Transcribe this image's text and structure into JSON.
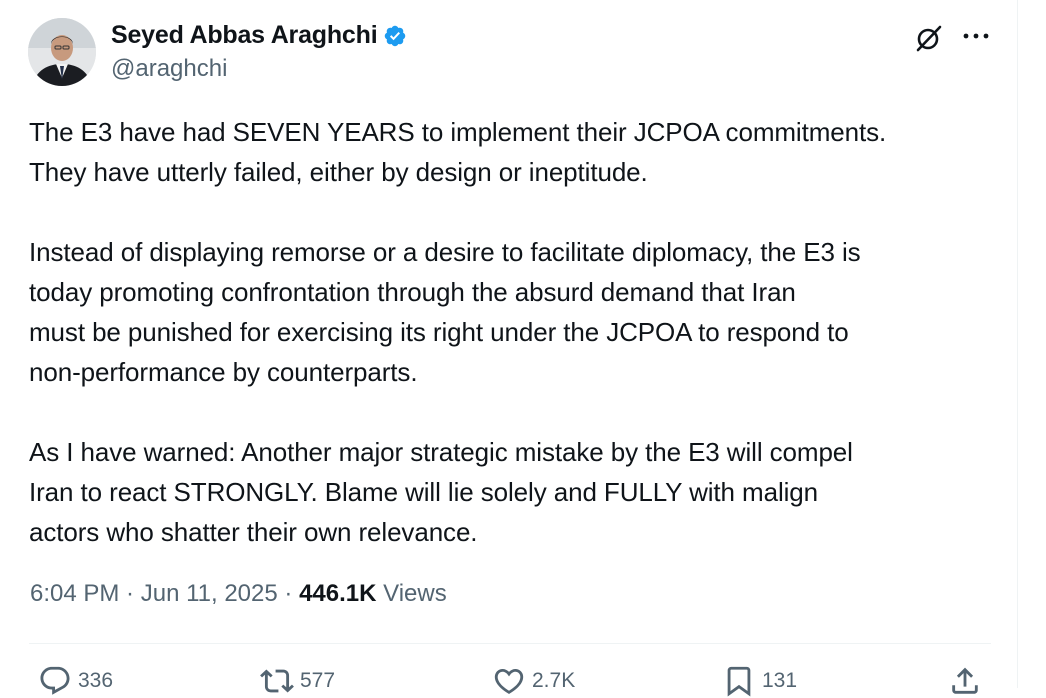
{
  "author": {
    "display_name": "Seyed Abbas Araghchi",
    "handle": "@araghchi",
    "verified": true,
    "verified_color": "#1d9bf0"
  },
  "tweet": {
    "paragraphs": [
      {
        "lines": [
          "The E3 have had SEVEN YEARS to implement their JCPOA commitments.",
          "They have utterly failed, either by design or ineptitude."
        ]
      },
      {
        "lines": [
          "Instead of displaying remorse or a desire to facilitate diplomacy, the E3 is",
          "today promoting confrontation through the absurd demand that Iran",
          "must be punished for exercising its right under the JCPOA to respond to",
          "non-performance by counterparts."
        ]
      },
      {
        "lines": [
          "As I have warned: Another major strategic mistake by the E3 will compel",
          "Iran to react STRONGLY. Blame will lie solely and FULLY with malign",
          "actors who shatter their own relevance."
        ]
      }
    ]
  },
  "meta": {
    "time": "6:04 PM",
    "separator": " · ",
    "date": "Jun 11, 2025",
    "views_count": "446.1K",
    "views_label": " Views"
  },
  "actions": {
    "replies": "336",
    "reposts": "577",
    "likes": "2.7K",
    "bookmarks": "131"
  },
  "icons": {
    "top_right": [
      "grok-icon",
      "more-icon"
    ],
    "actions": [
      "reply-icon",
      "repost-icon",
      "like-icon",
      "bookmark-icon",
      "share-icon"
    ]
  }
}
